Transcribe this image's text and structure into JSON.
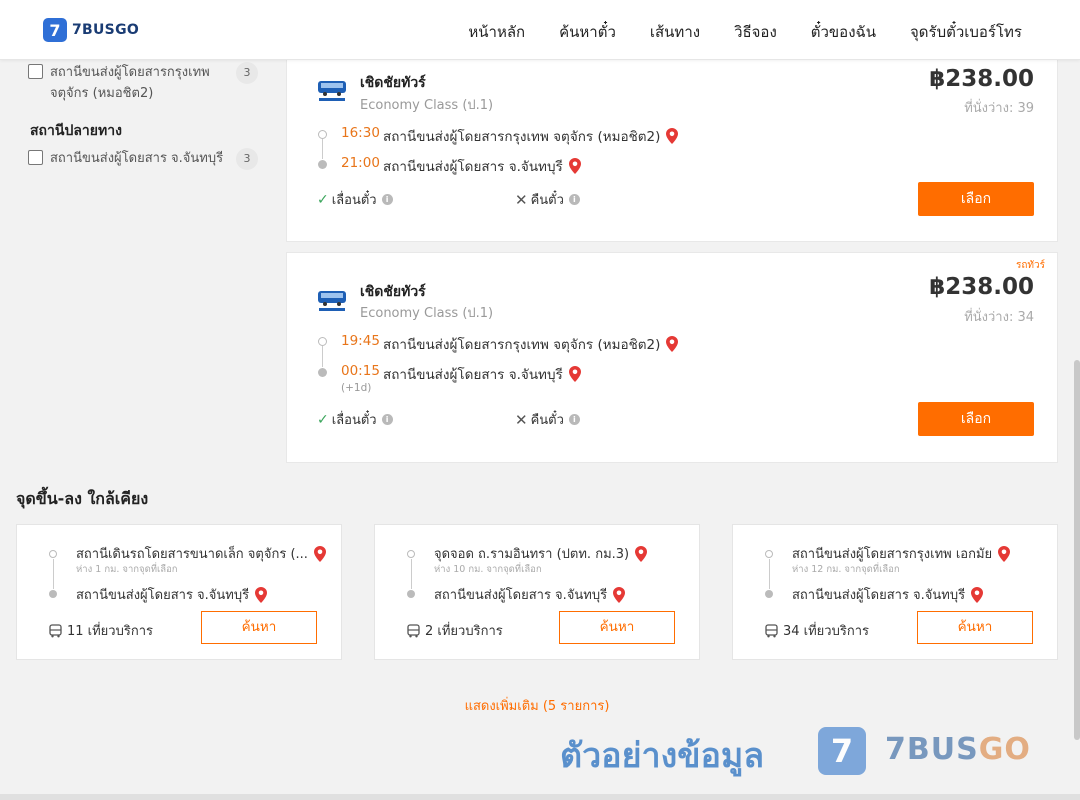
{
  "header": {
    "logo_mark": "7",
    "logo_text": "7BUSGO",
    "nav": [
      "หน้าหลัก",
      "ค้นหาตั๋ว",
      "เส้นทาง",
      "วิธีจอง",
      "ตั๋วของฉัน",
      "จุดรับตั๋วเบอร์โทร"
    ]
  },
  "sidebar": {
    "origin_filter": {
      "label": "สถานีขนส่งผู้โดยสารกรุงเทพ จตุจักร (หมอชิต2)",
      "count": "3",
      "checked": false
    },
    "destination_heading": "สถานีปลายทาง",
    "destination_filter": {
      "label": "สถานีขนส่งผู้โดยสาร จ.จันทบุรี",
      "count": "3",
      "checked": false
    }
  },
  "trips": [
    {
      "operator": "เชิดชัยทัวร์",
      "class": "Economy Class (ป.1)",
      "price": "฿238.00",
      "seats": "ที่นั่งว่าง: 39",
      "depart_time": "16:30",
      "depart_stop": "สถานีขนส่งผู้โดยสารกรุงเทพ จตุจักร (หมอชิต2)",
      "arrive_time": "21:00",
      "arrive_stop": "สถานีขนส่งผู้โดยสาร จ.จันทบุรี",
      "reschedule": "เลื่อนตั๋ว",
      "refund": "คืนตั๋ว",
      "select_label": "เลือก"
    },
    {
      "tag": "รถทัวร์",
      "operator": "เชิดชัยทัวร์",
      "class": "Economy Class (ป.1)",
      "price": "฿238.00",
      "seats": "ที่นั่งว่าง: 34",
      "depart_time": "19:45",
      "depart_stop": "สถานีขนส่งผู้โดยสารกรุงเทพ จตุจักร (หมอชิต2)",
      "arrive_time": "00:15",
      "plus_day": "(+1d)",
      "arrive_stop": "สถานีขนส่งผู้โดยสาร จ.จันทบุรี",
      "reschedule": "เลื่อนตั๋ว",
      "refund": "คืนตั๋ว",
      "select_label": "เลือก"
    }
  ],
  "nearby": {
    "title": "จุดขึ้น-ลง ใกล้เคียง",
    "cards": [
      {
        "from": "สถานีเดินรถโดยสารขนาดเล็ก จตุจักร (...",
        "distance": "ห่าง 1 กม. จากจุดที่เลือก",
        "to": "สถานีขนส่งผู้โดยสาร จ.จันทบุรี",
        "trips": "11 เที่ยวบริการ",
        "button": "ค้นหา"
      },
      {
        "from": "จุดจอด ถ.รามอินทรา (ปตท. กม.3)",
        "distance": "ห่าง 10 กม. จากจุดที่เลือก",
        "to": "สถานีขนส่งผู้โดยสาร จ.จันทบุรี",
        "trips": "2 เที่ยวบริการ",
        "button": "ค้นหา"
      },
      {
        "from": "สถานีขนส่งผู้โดยสารกรุงเทพ เอกมัย",
        "distance": "ห่าง 12 กม. จากจุดที่เลือก",
        "to": "สถานีขนส่งผู้โดยสาร จ.จันทบุรี",
        "trips": "34 เที่ยวบริการ",
        "button": "ค้นหา"
      }
    ],
    "show_more": "แสดงเพิ่มเติม (5 รายการ)"
  },
  "watermark": {
    "text": "ตัวอย่างข้อมูล",
    "logo_mark": "7",
    "brand_a": "7BUS",
    "brand_b": "GO"
  },
  "colors": {
    "accent": "#ff6d00",
    "time": "#e8751a",
    "pin": "#e53935",
    "check": "#3aa55b",
    "brand": "#2f6fd6"
  }
}
